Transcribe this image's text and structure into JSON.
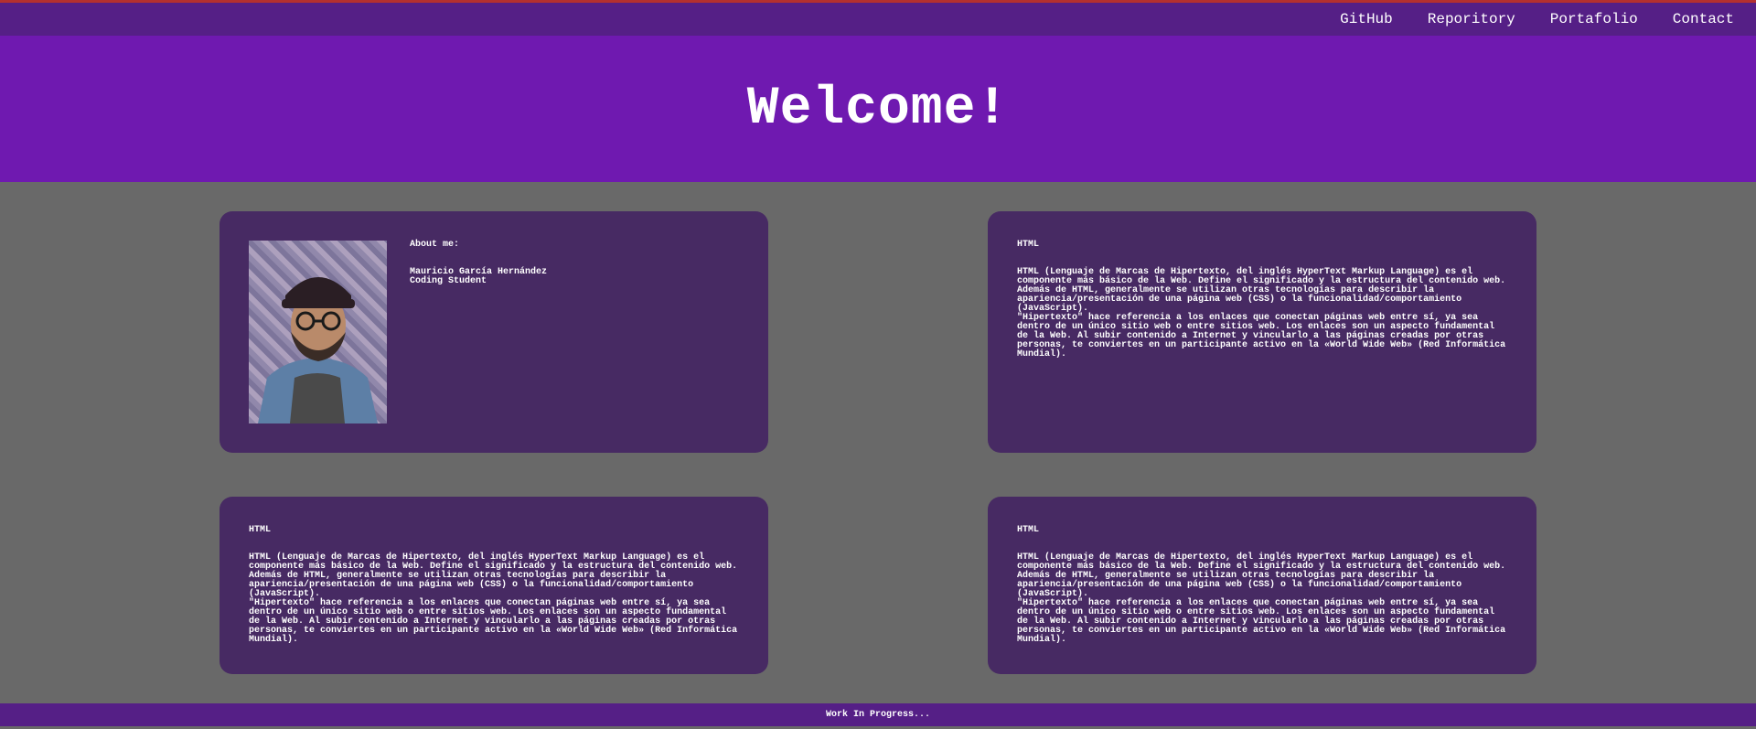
{
  "nav": {
    "links": [
      "GitHub",
      "Reporitory",
      "Portafolio",
      "Contact"
    ]
  },
  "hero": {
    "title": "Welcome!"
  },
  "about": {
    "heading": "About me:",
    "name": "Mauricio García Hernández",
    "role": "Coding Student"
  },
  "cards": [
    {
      "title": "HTML",
      "text": "HTML (Lenguaje de Marcas de Hipertexto, del inglés HyperText Markup Language) es el\ncomponente más básico de la Web. Define el significado y la estructura del contenido web.\nAdemás de HTML, generalmente se utilizan otras tecnologías para describir la\napariencia/presentación de una página web (CSS) o la funcionalidad/comportamiento\n(JavaScript).\n\"Hipertexto\" hace referencia a los enlaces que conectan páginas web entre sí, ya sea\ndentro de un único sitio web o entre sitios web. Los enlaces son un aspecto fundamental\nde la Web. Al subir contenido a Internet y vincularlo a las páginas creadas por otras\npersonas, te conviertes en un participante activo en la «World Wide Web» (Red Informática\nMundial)."
    },
    {
      "title": "HTML",
      "text": "HTML (Lenguaje de Marcas de Hipertexto, del inglés HyperText Markup Language) es el\ncomponente más básico de la Web. Define el significado y la estructura del contenido web.\nAdemás de HTML, generalmente se utilizan otras tecnologías para describir la\napariencia/presentación de una página web (CSS) o la funcionalidad/comportamiento\n(JavaScript).\n\"Hipertexto\" hace referencia a los enlaces que conectan páginas web entre sí, ya sea\ndentro de un único sitio web o entre sitios web. Los enlaces son un aspecto fundamental\nde la Web. Al subir contenido a Internet y vincularlo a las páginas creadas por otras\npersonas, te conviertes en un participante activo en la «World Wide Web» (Red Informática\nMundial)."
    },
    {
      "title": "HTML",
      "text": "HTML (Lenguaje de Marcas de Hipertexto, del inglés HyperText Markup Language) es el\ncomponente más básico de la Web. Define el significado y la estructura del contenido web.\nAdemás de HTML, generalmente se utilizan otras tecnologías para describir la\napariencia/presentación de una página web (CSS) o la funcionalidad/comportamiento\n(JavaScript).\n\"Hipertexto\" hace referencia a los enlaces que conectan páginas web entre sí, ya sea\ndentro de un único sitio web o entre sitios web. Los enlaces son un aspecto fundamental\nde la Web. Al subir contenido a Internet y vincularlo a las páginas creadas por otras\npersonas, te conviertes en un participante activo en la «World Wide Web» (Red Informática\nMundial)."
    }
  ],
  "footer": {
    "text": "Work In Progress..."
  },
  "colors": {
    "navbar": "#551f86",
    "hero": "#6f19b0",
    "background": "#696969",
    "card": "#472a63"
  }
}
